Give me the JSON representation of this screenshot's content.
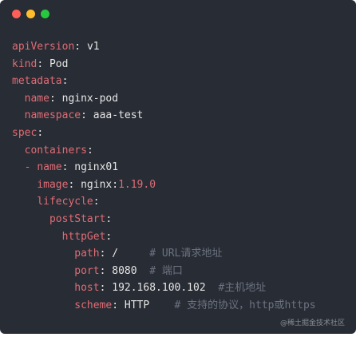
{
  "window": {
    "traffic_lights": [
      {
        "name": "close",
        "color": "#ff5f56"
      },
      {
        "name": "minimize",
        "color": "#ffbd2e"
      },
      {
        "name": "maximize",
        "color": "#27c93f"
      }
    ]
  },
  "colors": {
    "background": "#282c34",
    "key": "#e06c75",
    "value": "#e6e6e6",
    "comment": "#6b7280"
  },
  "code": {
    "lines": [
      [
        {
          "t": "apiVersion",
          "s": "k"
        },
        {
          "t": ": ",
          "s": "v"
        },
        {
          "t": "v1",
          "s": "v"
        }
      ],
      [
        {
          "t": "kind",
          "s": "k"
        },
        {
          "t": ": ",
          "s": "v"
        },
        {
          "t": "Pod",
          "s": "v"
        }
      ],
      [
        {
          "t": "metadata",
          "s": "k"
        },
        {
          "t": ":",
          "s": "v"
        }
      ],
      [
        {
          "t": "  ",
          "s": "v"
        },
        {
          "t": "name",
          "s": "k"
        },
        {
          "t": ": ",
          "s": "v"
        },
        {
          "t": "nginx-pod",
          "s": "v"
        }
      ],
      [
        {
          "t": "  ",
          "s": "v"
        },
        {
          "t": "namespace",
          "s": "k"
        },
        {
          "t": ": ",
          "s": "v"
        },
        {
          "t": "aaa-test",
          "s": "v"
        }
      ],
      [
        {
          "t": "spec",
          "s": "k"
        },
        {
          "t": ":",
          "s": "v"
        }
      ],
      [
        {
          "t": "  ",
          "s": "v"
        },
        {
          "t": "containers",
          "s": "k"
        },
        {
          "t": ":",
          "s": "v"
        }
      ],
      [
        {
          "t": "  ",
          "s": "v"
        },
        {
          "t": "- ",
          "s": "k"
        },
        {
          "t": "name",
          "s": "k"
        },
        {
          "t": ": ",
          "s": "v"
        },
        {
          "t": "nginx01",
          "s": "v"
        }
      ],
      [
        {
          "t": "    ",
          "s": "v"
        },
        {
          "t": "image",
          "s": "k"
        },
        {
          "t": ": ",
          "s": "v"
        },
        {
          "t": "nginx:",
          "s": "v"
        },
        {
          "t": "1.19.0",
          "s": "n"
        }
      ],
      [
        {
          "t": "    ",
          "s": "v"
        },
        {
          "t": "lifecycle",
          "s": "k"
        },
        {
          "t": ":",
          "s": "v"
        }
      ],
      [
        {
          "t": "      ",
          "s": "v"
        },
        {
          "t": "postStart",
          "s": "k"
        },
        {
          "t": ":",
          "s": "v"
        }
      ],
      [
        {
          "t": "        ",
          "s": "v"
        },
        {
          "t": "httpGet",
          "s": "k"
        },
        {
          "t": ":",
          "s": "v"
        }
      ],
      [
        {
          "t": "          ",
          "s": "v"
        },
        {
          "t": "path",
          "s": "k"
        },
        {
          "t": ": ",
          "s": "v"
        },
        {
          "t": "/     ",
          "s": "v"
        },
        {
          "t": "# URL请求地址",
          "s": "c"
        }
      ],
      [
        {
          "t": "          ",
          "s": "v"
        },
        {
          "t": "port",
          "s": "k"
        },
        {
          "t": ": ",
          "s": "v"
        },
        {
          "t": "8080",
          "s": "v"
        },
        {
          "t": "  ",
          "s": "v"
        },
        {
          "t": "# 端口",
          "s": "c"
        }
      ],
      [
        {
          "t": "          ",
          "s": "v"
        },
        {
          "t": "host",
          "s": "k"
        },
        {
          "t": ": ",
          "s": "v"
        },
        {
          "t": "192.168.100.102",
          "s": "v"
        },
        {
          "t": "  ",
          "s": "v"
        },
        {
          "t": "#主机地址",
          "s": "c"
        }
      ],
      [
        {
          "t": "          ",
          "s": "v"
        },
        {
          "t": "scheme",
          "s": "k"
        },
        {
          "t": ": ",
          "s": "v"
        },
        {
          "t": "HTTP",
          "s": "v"
        },
        {
          "t": "    ",
          "s": "v"
        },
        {
          "t": "# 支持的协议，http或https",
          "s": "c"
        }
      ]
    ]
  },
  "watermark": "@稀土掘金技术社区"
}
